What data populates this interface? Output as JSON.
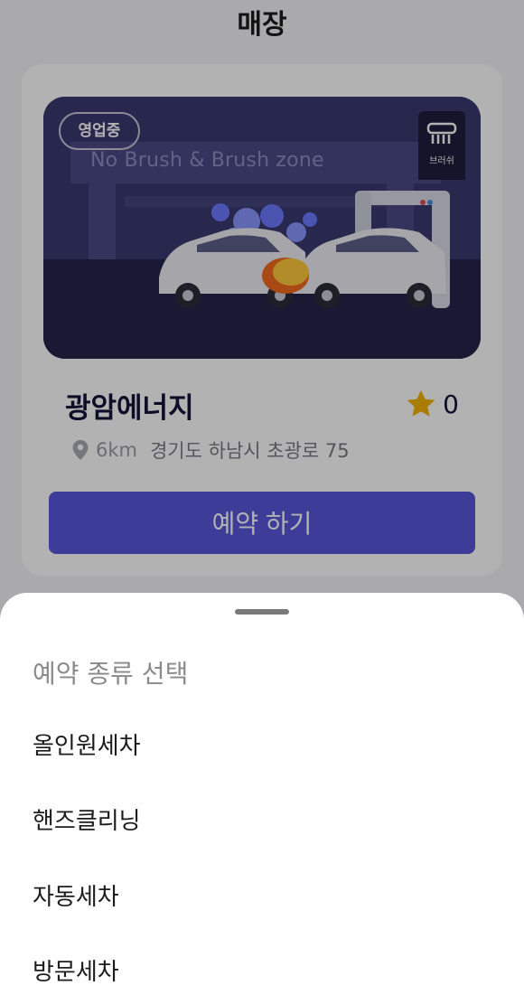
{
  "header": {
    "title": "매장"
  },
  "store": {
    "status_badge": "영업중",
    "zone_text": "No Brush & Brush zone",
    "brush_badge_label": "브러쉬",
    "name": "광암에너지",
    "rating": "0",
    "distance": "6km",
    "address": "경기도 하남시 초광로 75",
    "reserve_button": "예약 하기"
  },
  "sheet": {
    "title": "예약 종류 선택",
    "options": [
      {
        "label": "올인원세차"
      },
      {
        "label": "핸즈클리닝"
      },
      {
        "label": "자동세차"
      },
      {
        "label": "방문세차"
      }
    ]
  },
  "colors": {
    "accent": "#5a57dc",
    "star": "#f3b400",
    "banner_bg": "#3a3a72",
    "banner_floor": "#25254a"
  }
}
